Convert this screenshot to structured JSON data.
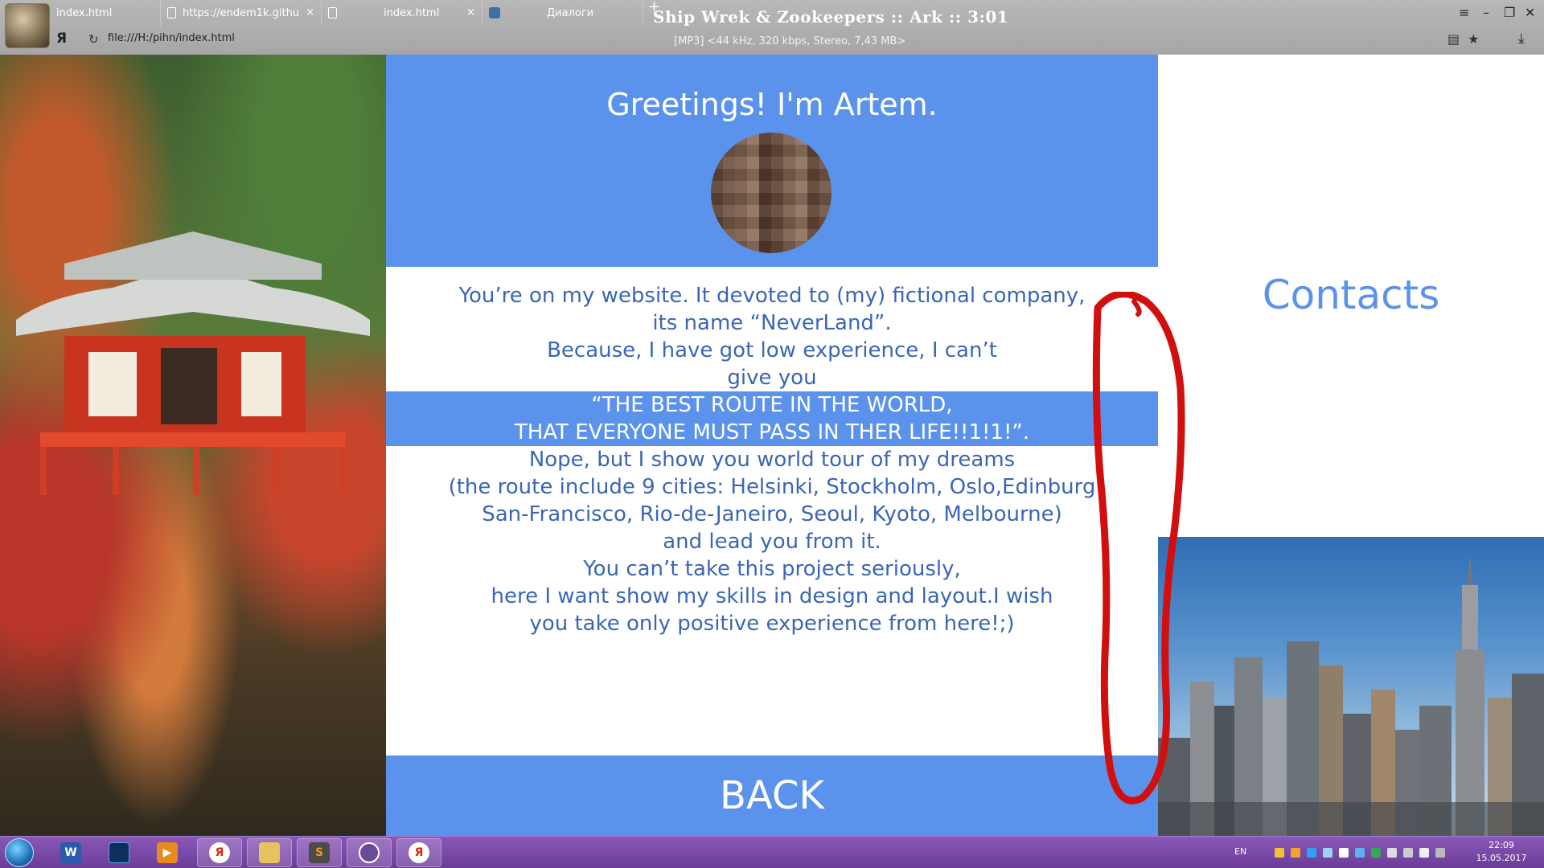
{
  "browser": {
    "tabs": [
      {
        "label": "index.html",
        "icon": "document-icon"
      },
      {
        "label": "https://endem1k.githu",
        "icon": "document-icon"
      },
      {
        "label": "index.html",
        "icon": "document-icon"
      },
      {
        "label": "Диалоги",
        "icon": "vk-icon"
      }
    ],
    "tab_close": "×",
    "new_tab": "+",
    "address": "file:///H:/pihn/index.html",
    "yandex_letter": "Я"
  },
  "player": {
    "title": "Ship Wrek & Zookeepers :: Ark :: 3:01",
    "info": "[MP3] <44 kHz, 320 kbps, Stereo, 7,43 MB>"
  },
  "window_controls": {
    "menu": "≡",
    "minimize": "–",
    "restore": "❐",
    "close": "✕"
  },
  "page": {
    "greeting": "Greetings! I'm Artem.",
    "intro_lines": [
      "You’re on my website. It devoted to (my) fictional company,",
      "its name “NeverLand”.",
      "Because, I have got low experience, I can’t",
      "give you"
    ],
    "highlight_lines": [
      "“THE BEST ROUTE IN THE WORLD,",
      "THAT EVERYONE MUST PASS IN THER LIFE!!1!1!”."
    ],
    "outro_lines": [
      "Nope, but I show you world tour of my dreams",
      "(the route include 9 cities: Helsinki, Stockholm, Oslo,Edinburg",
      "San-Francisco, Rio-de-Janeiro, Seoul, Kyoto, Melbourne)",
      "and lead you from it.",
      "You can’t take this project seriously,",
      "here I want show my skills in design and layout.I wish",
      "you take only positive experience from here!;)"
    ],
    "back": "BACK",
    "contacts": "Contacts"
  },
  "colors": {
    "accent": "#5b93ec",
    "text": "#3a66b5",
    "annotation": "#d10f0f",
    "taskbar": "#7a4aa8"
  },
  "taskbar": {
    "apps": [
      "start-orb",
      "word-icon",
      "blizzard-icon",
      "media-player-icon",
      "yandex-browser-icon",
      "explorer-icon",
      "sublime-icon",
      "cat-icon",
      "yandex-browser-icon"
    ],
    "word_letter": "W",
    "sublime_letter": "S",
    "language": "EN",
    "time": "22:09",
    "date": "15.05.2017"
  }
}
